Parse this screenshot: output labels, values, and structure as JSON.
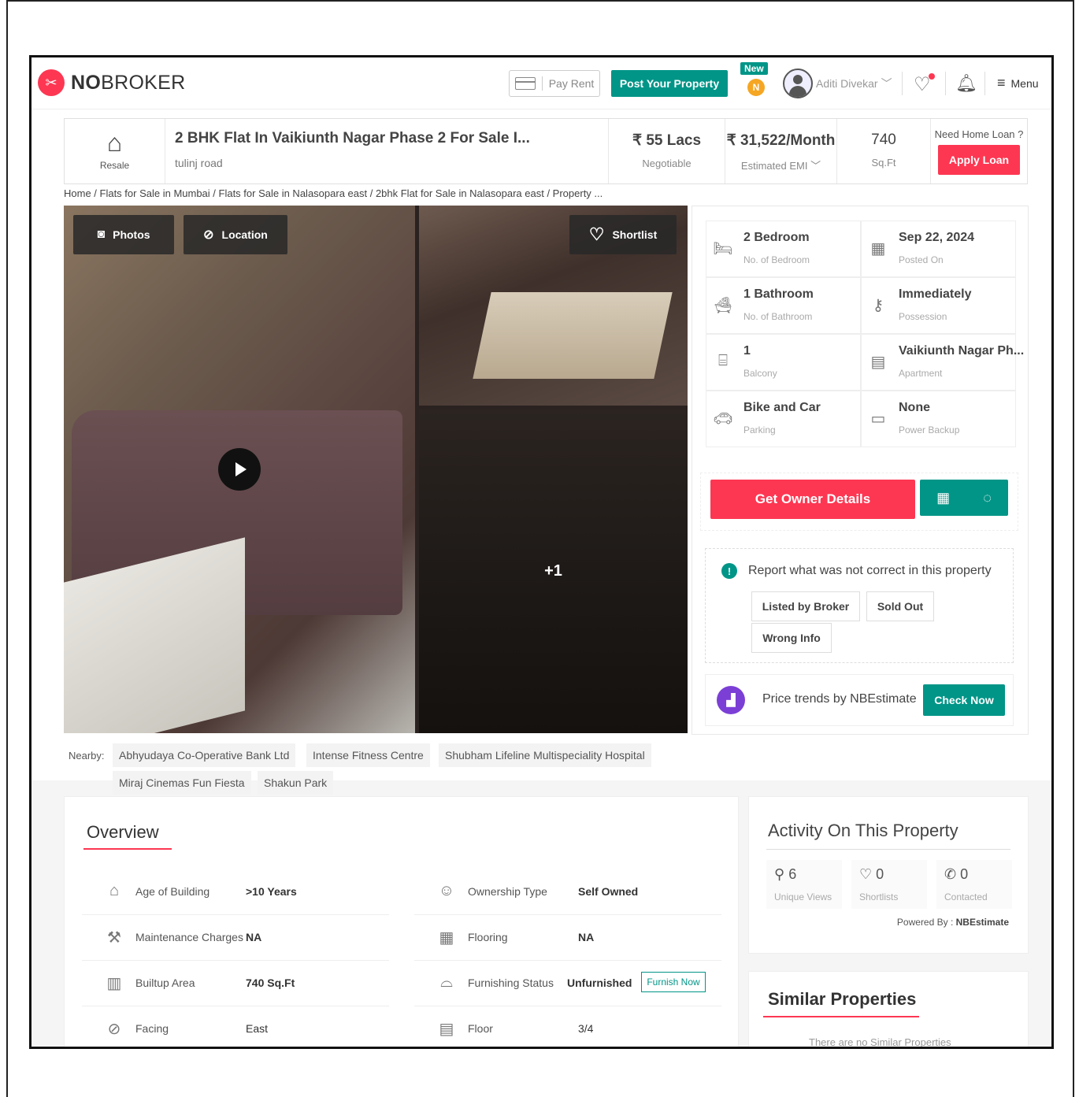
{
  "header": {
    "logo_text_bold": "NO",
    "logo_text_rest": "BROKER",
    "pay_rent": "Pay Rent",
    "post_property": "Post Your Property",
    "new_badge": "New",
    "coin_letter": "N",
    "user_name": "Aditi Divekar",
    "menu": "Menu"
  },
  "summary": {
    "resale_label": "Resale",
    "title": "2 BHK Flat In Vaikiunth Nagar Phase 2 For Sale I...",
    "subtitle": "tulinj road",
    "price": "₹ 55 Lacs",
    "price_note": "Negotiable",
    "emi": "₹ 31,522/Month",
    "emi_note": "Estimated EMI",
    "area": "740",
    "area_unit": "Sq.Ft",
    "loan_question": "Need Home Loan ?",
    "apply_loan": "Apply Loan"
  },
  "breadcrumb": "Home / Flats for Sale in Mumbai / Flats for Sale in Nalasopara east / 2bhk Flat for Sale in Nalasopara east / Property ...",
  "gallery": {
    "photos_btn": "Photos",
    "location_btn": "Location",
    "shortlist_btn": "Shortlist",
    "more_count": "+1"
  },
  "details": [
    {
      "value": "2 Bedroom",
      "label": "No. of Bedroom",
      "icon": "bed-icon"
    },
    {
      "value": "Sep 22, 2024",
      "label": "Posted On",
      "icon": "calendar-icon"
    },
    {
      "value": "1 Bathroom",
      "label": "No. of Bathroom",
      "icon": "bathtub-icon"
    },
    {
      "value": "Immediately",
      "label": "Possession",
      "icon": "key-icon"
    },
    {
      "value": "1",
      "label": "Balcony",
      "icon": "balcony-icon"
    },
    {
      "value": "Vaikiunth Nagar Ph...",
      "label": "Apartment",
      "icon": "building-icon"
    },
    {
      "value": "Bike and Car",
      "label": "Parking",
      "icon": "car-icon"
    },
    {
      "value": "None",
      "label": "Power Backup",
      "icon": "battery-icon"
    }
  ],
  "actions": {
    "owner_details": "Get Owner Details"
  },
  "report": {
    "title": "Report what was not correct in this property",
    "chips": [
      "Listed by Broker",
      "Sold Out",
      "Wrong Info"
    ]
  },
  "trend": {
    "text": "Price trends by NBEstimate",
    "button": "Check Now"
  },
  "nearby": {
    "label": "Nearby:",
    "places": [
      "Abhyudaya Co-Operative Bank Ltd",
      "Intense Fitness Centre",
      "Shubham Lifeline Multispeciality Hospital",
      "Miraj Cinemas Fun Fiesta",
      "Shakun Park"
    ]
  },
  "overview": {
    "title": "Overview",
    "rows": [
      {
        "key": "Age of Building",
        "value": ">10 Years",
        "icon": "building-age-icon"
      },
      {
        "key": "Ownership Type",
        "value": "Self Owned",
        "icon": "owner-icon"
      },
      {
        "key": "Maintenance Charges",
        "value": "NA",
        "icon": "hammer-icon"
      },
      {
        "key": "Flooring",
        "value": "NA",
        "icon": "tiles-icon"
      },
      {
        "key": "Builtup Area",
        "value": "740 Sq.Ft",
        "icon": "area-icon"
      },
      {
        "key": "Furnishing Status",
        "value": "Unfurnished",
        "icon": "sofa-icon"
      },
      {
        "key": "Facing",
        "value": "East",
        "icon": "compass-icon"
      },
      {
        "key": "Floor",
        "value": "3/4",
        "icon": "floor-icon"
      }
    ],
    "furnish_now": "Furnish Now"
  },
  "activity": {
    "title": "Activity On This Property",
    "stats": [
      {
        "count": "6",
        "label": "Unique Views",
        "icon": "user-icon"
      },
      {
        "count": "0",
        "label": "Shortlists",
        "icon": "heart-icon"
      },
      {
        "count": "0",
        "label": "Contacted",
        "icon": "phone-icon"
      }
    ],
    "powered_by": "Powered By :",
    "powered_brand": "NBEstimate"
  },
  "similar": {
    "title": "Similar Properties",
    "empty": "There are no Similar Properties"
  },
  "colors": {
    "brand_red": "#fd3752",
    "brand_teal": "#009587"
  }
}
